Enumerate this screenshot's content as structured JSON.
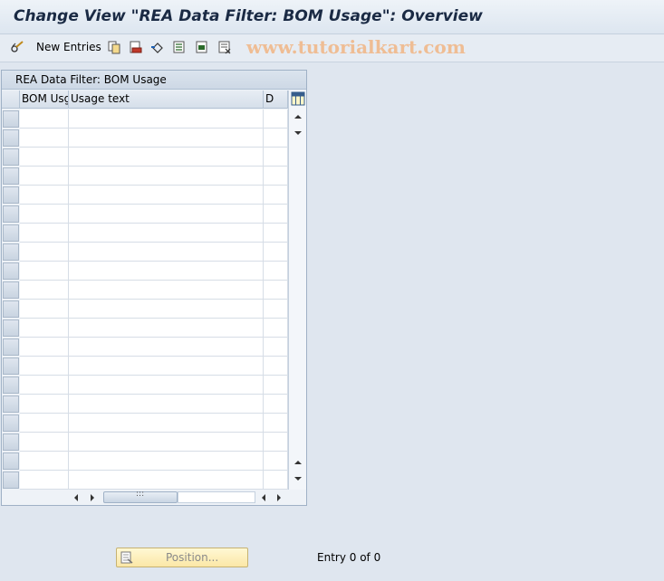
{
  "window": {
    "title": "Change View \"REA Data Filter: BOM Usage\": Overview"
  },
  "toolbar": {
    "new_entries_label": "New Entries",
    "watermark": "www.tutorialkart.com",
    "icons": [
      "display-change-icon",
      "copy-icon",
      "delete-icon",
      "undo-icon",
      "select-all-icon",
      "select-block-icon",
      "deselect-all-icon"
    ]
  },
  "table": {
    "title": "REA Data Filter: BOM Usage",
    "columns": [
      "BOM Usg",
      "Usage text",
      "D"
    ],
    "rows": [
      [
        "",
        "",
        ""
      ],
      [
        "",
        "",
        ""
      ],
      [
        "",
        "",
        ""
      ],
      [
        "",
        "",
        ""
      ],
      [
        "",
        "",
        ""
      ],
      [
        "",
        "",
        ""
      ],
      [
        "",
        "",
        ""
      ],
      [
        "",
        "",
        ""
      ],
      [
        "",
        "",
        ""
      ],
      [
        "",
        "",
        ""
      ],
      [
        "",
        "",
        ""
      ],
      [
        "",
        "",
        ""
      ],
      [
        "",
        "",
        ""
      ],
      [
        "",
        "",
        ""
      ],
      [
        "",
        "",
        ""
      ],
      [
        "",
        "",
        ""
      ],
      [
        "",
        "",
        ""
      ],
      [
        "",
        "",
        ""
      ],
      [
        "",
        "",
        ""
      ],
      [
        "",
        "",
        ""
      ]
    ]
  },
  "footer": {
    "position_button_label": "Position...",
    "entry_text": "Entry 0 of 0"
  }
}
